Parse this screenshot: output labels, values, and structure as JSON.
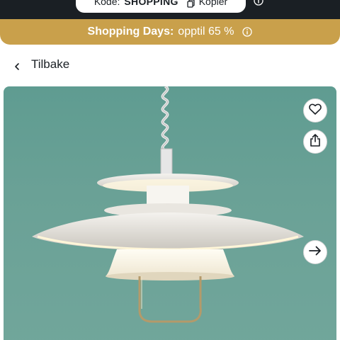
{
  "promo": {
    "code_label": "Kode:",
    "code_value": "SHOPPING",
    "copy_label": "Kopier"
  },
  "banner": {
    "title": "Shopping Days:",
    "text": "opptil 65 %"
  },
  "nav": {
    "back_label": "Tilbake"
  },
  "colors": {
    "topbar": "#1a1f24",
    "banner": "#c9a04b",
    "image_bg": "#6aa196"
  },
  "icons": {
    "favorite": "heart-icon",
    "share": "share-icon",
    "next": "arrow-right-icon",
    "back": "chevron-left-icon",
    "info": "info-icon",
    "copy": "copy-icon"
  }
}
